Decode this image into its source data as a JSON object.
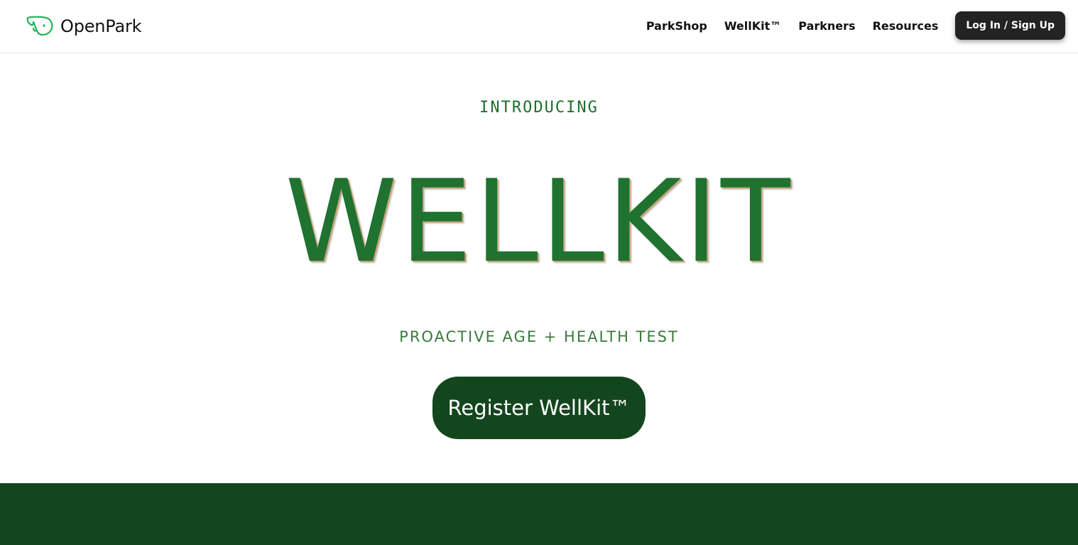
{
  "header": {
    "brand_name": "OpenPark",
    "logo_icon": "dog-head-icon",
    "nav": [
      {
        "label": "ParkShop"
      },
      {
        "label": "WellKit™"
      },
      {
        "label": "Parkners"
      },
      {
        "label": "Resources"
      }
    ],
    "login_label": "Log In / Sign Up"
  },
  "hero": {
    "eyebrow": "INTRODUCING",
    "title": "WELLKIT",
    "subtitle": "PROACTIVE AGE + HEALTH TEST",
    "cta_label": "Register WellKit™"
  },
  "colors": {
    "brand_green": "#14461e",
    "title_green": "#1f7230",
    "logo_green": "#22b35a",
    "login_bg": "#232323"
  }
}
